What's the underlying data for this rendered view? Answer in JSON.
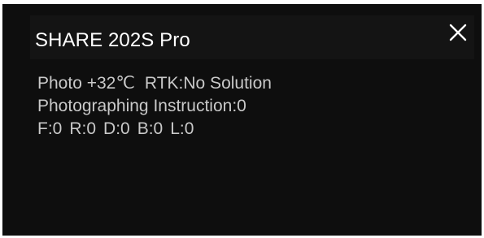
{
  "dialog": {
    "title": "SHARE 202S Pro",
    "close_icon": "close-icon",
    "status": {
      "photo_temp": "Photo +32℃",
      "rtk": "RTK:No Solution"
    },
    "instruction": "Photographing Instruction:0",
    "cameras": [
      {
        "label": "F:0"
      },
      {
        "label": "R:0"
      },
      {
        "label": "D:0"
      },
      {
        "label": "B:0"
      },
      {
        "label": "L:0"
      }
    ]
  },
  "colors": {
    "panel_background": "#0e0e0e",
    "header_background": "#141414",
    "title_text": "#ffffff",
    "info_text": "#c9c9c9"
  }
}
